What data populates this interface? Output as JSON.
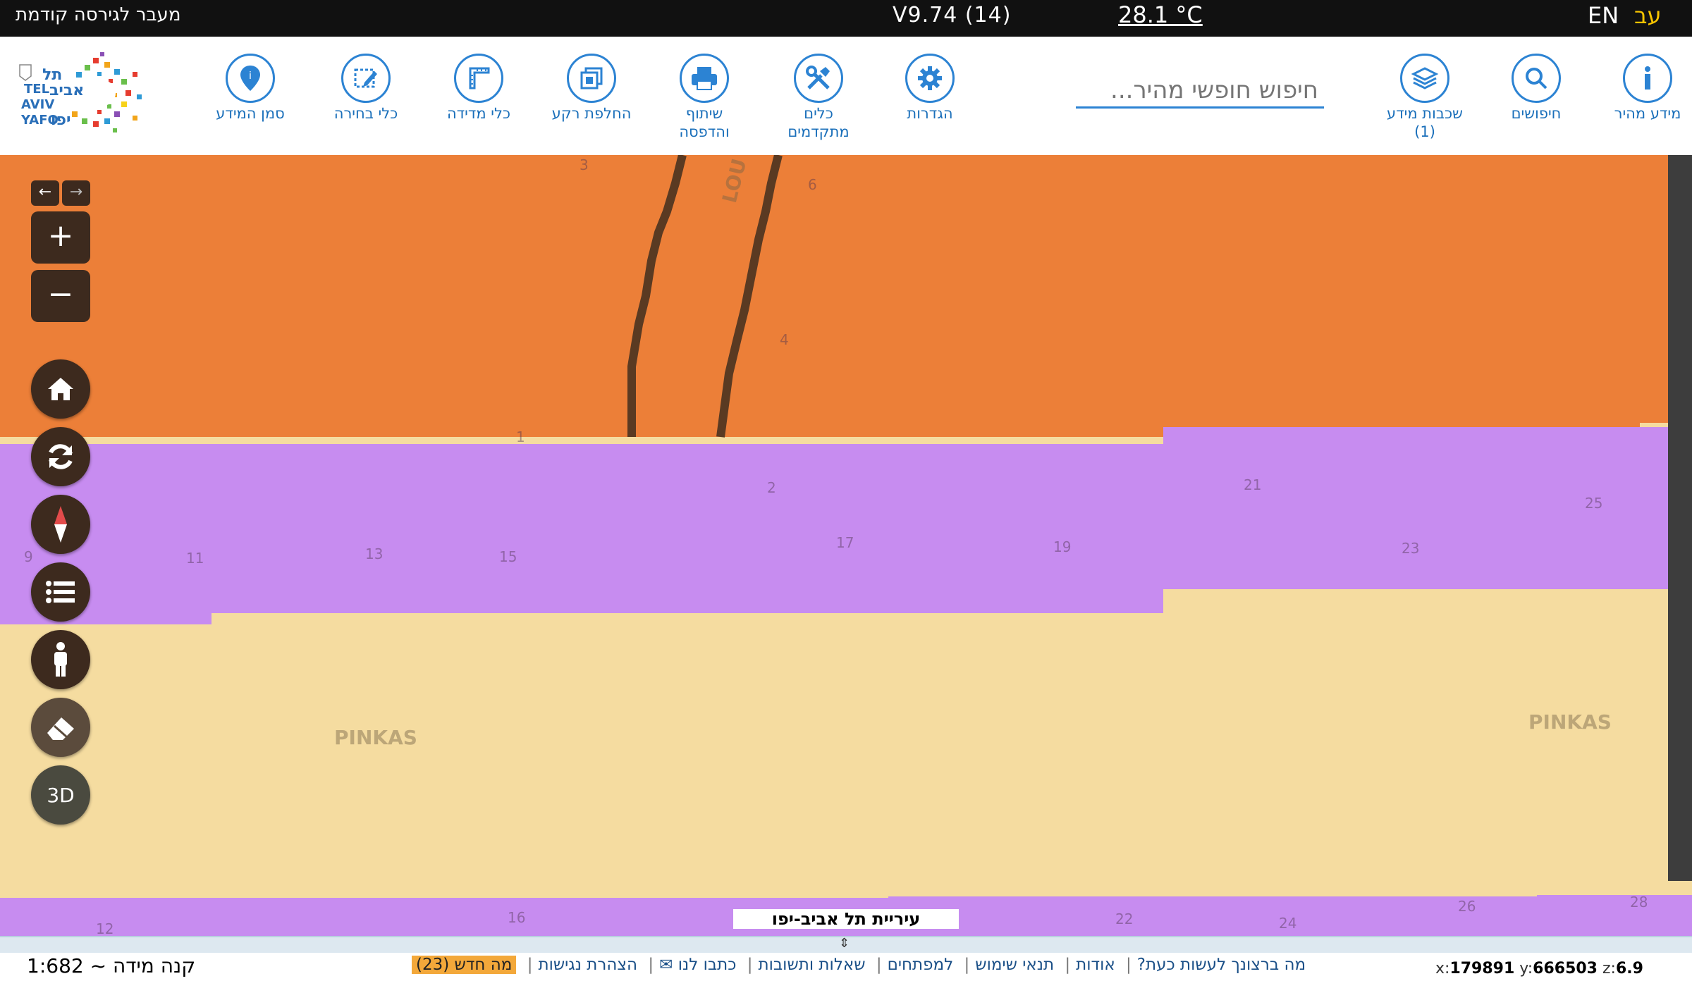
{
  "topbar": {
    "prev_version": "מעבר לגירסה קודמת",
    "version": "V9.74 (14)",
    "temperature": "28.1 °C",
    "lang_en": "EN",
    "lang_he": "עב"
  },
  "toolbar": {
    "quick_info": "מידע מהיר",
    "searches": "חיפושים",
    "layers": "שכבות מידע\n(1)",
    "search_placeholder": "חיפוש חופשי מהיר...",
    "settings": "הגדרות",
    "advanced_tools": "כלים\nמתקדמים",
    "share_print": "שיתוף\nוהדפסה",
    "basemap": "החלפת רקע",
    "measure": "כלי מדידה",
    "select": "כלי בחירה",
    "mark_info": "סמן המידע"
  },
  "logo": {
    "line1": "תל",
    "line2": "TEL",
    "line3": "אביב",
    "line4": "AVIV",
    "line5": "יפו",
    "line6": "YAFO"
  },
  "map": {
    "street_left": "PINKAS",
    "street_right": "PINKAS",
    "street_top": "LOU",
    "parcel_numbers": [
      "3",
      "6",
      "4",
      "1",
      "2",
      "17",
      "19",
      "21",
      "23",
      "25",
      "9",
      "11",
      "13",
      "15",
      "12",
      "16",
      "22",
      "24",
      "26",
      "28"
    ],
    "city_label": "עיריית תל אביב-יפו",
    "colors": {
      "orange": "#ec7f38",
      "purple": "#c78cf0",
      "beige": "#f5dca0"
    }
  },
  "controls": {
    "three_d": "3D",
    "zoom_in": "+",
    "zoom_out": "−",
    "back": "←",
    "forward": "→"
  },
  "footer": {
    "scale": "קנה מידה ~ 1:682",
    "links": [
      "מה ברצונך לעשות כעת?",
      "אודות",
      "תנאי שימוש",
      "למפתחים",
      "שאלות ותשובות",
      "כתבו לנו ✉",
      "הצהרת נגישות"
    ],
    "whats_new": "מה חדש (23)",
    "coord_x_label": "x:",
    "coord_x": "179891",
    "coord_y_label": "y:",
    "coord_y": "666503",
    "coord_z_label": "z:",
    "coord_z": "6.9"
  }
}
